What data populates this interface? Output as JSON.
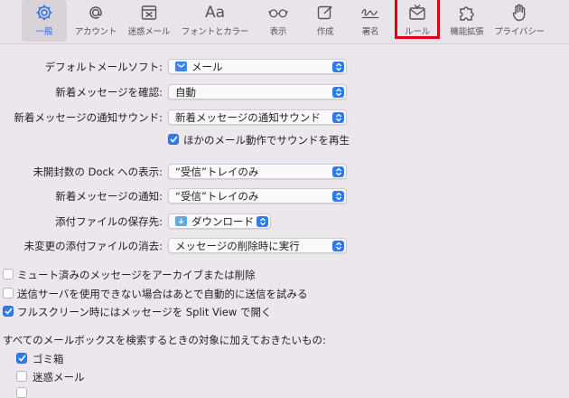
{
  "toolbar": {
    "items": [
      {
        "label": "一般",
        "icon": "gear-icon"
      },
      {
        "label": "アカウント",
        "icon": "at-sign-icon"
      },
      {
        "label": "迷惑メール",
        "icon": "junk-mail-icon"
      },
      {
        "label": "フォントとカラー",
        "icon": "font-icon",
        "glyph": "Aa"
      },
      {
        "label": "表示",
        "icon": "glasses-icon"
      },
      {
        "label": "作成",
        "icon": "compose-icon"
      },
      {
        "label": "署名",
        "icon": "signature-icon"
      },
      {
        "label": "ルール",
        "icon": "rules-envelope-icon"
      },
      {
        "label": "機能拡張",
        "icon": "puzzle-piece-icon"
      },
      {
        "label": "プライバシー",
        "icon": "hand-icon"
      }
    ],
    "selected": "一般",
    "highlighted": "ルール"
  },
  "settings": {
    "default_mail": {
      "label": "デフォルトメールソフト:",
      "value": "メール",
      "icon": "mail-app-icon"
    },
    "check_new": {
      "label": "新着メッセージを確認:",
      "value": "自動"
    },
    "notify_sound": {
      "label": "新着メッセージの通知サウンド:",
      "value": "新着メッセージの通知サウンド"
    },
    "play_other_sounds": {
      "label": "ほかのメール動作でサウンドを再生",
      "checked": true
    },
    "dock_unread": {
      "label": "未開封数の Dock への表示:",
      "value": "“受信”トレイのみ"
    },
    "new_notifications": {
      "label": "新着メッセージの通知:",
      "value": "“受信”トレイのみ"
    },
    "downloads_folder": {
      "label": "添付ファイルの保存先:",
      "value": "ダウンロード",
      "icon": "folder-icon"
    },
    "remove_attachments": {
      "label": "未変更の添付ファイルの消去:",
      "value": "メッセージの削除時に実行"
    }
  },
  "checkboxes": [
    {
      "label": "ミュート済みのメッセージをアーカイブまたは削除",
      "checked": false
    },
    {
      "label": "送信サーバを使用できない場合はあとで自動的に送信を試みる",
      "checked": false
    },
    {
      "label": "フルスクリーン時にはメッセージを Split View で開く",
      "checked": true
    }
  ],
  "search_section": {
    "heading": "すべてのメールボックスを検索するときの対象に加えておきたいもの:",
    "items": [
      {
        "label": "ゴミ箱",
        "checked": true
      },
      {
        "label": "迷惑メール",
        "checked": false
      }
    ]
  },
  "colors": {
    "accent": "#2f7be8",
    "highlight": "#e00012",
    "background": "#ece7ec"
  }
}
